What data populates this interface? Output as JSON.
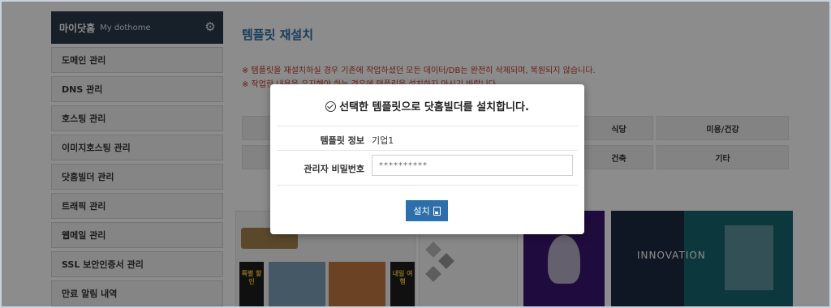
{
  "sidebar": {
    "header_title": "마이닷홈",
    "header_sub": "My dothome",
    "settings_icon": "gear-icon",
    "items": [
      {
        "label": "도메인 관리"
      },
      {
        "label": "DNS 관리"
      },
      {
        "label": "호스팅 관리"
      },
      {
        "label": "이미지호스팅 관리"
      },
      {
        "label": "닷홈빌더 관리"
      },
      {
        "label": "트래픽 관리"
      },
      {
        "label": "웹메일 관리"
      },
      {
        "label": "SSL 보안인증서 관리"
      },
      {
        "label": "만료 알림 내역"
      }
    ]
  },
  "main": {
    "title": "템플릿 재설치",
    "warning1": "※ 템플릿을 재설치하실 경우 기존에 작업하셨던 모든 데이터/DB는 완전히 삭제되며, 복원되지 않습니다.",
    "warning2": "※ 작업한 내용을 유지해야 하는 경우에 템플릿을 설치하지 마시기 바랍니다.",
    "categories": [
      "식당",
      "미용/건강",
      "건축",
      "기타"
    ],
    "thumbnails": {
      "banner1": "내일 여행",
      "banner2": "특별 할인",
      "innovation": "INNOVATION"
    }
  },
  "modal": {
    "title": "선택한 템플릿으로 닷홈빌더를 설치합니다.",
    "rows": [
      {
        "label": "템플릿 정보",
        "value": "기업1"
      },
      {
        "label": "관리자 비밀번호",
        "value": "**********"
      }
    ],
    "install_button": "설치"
  }
}
